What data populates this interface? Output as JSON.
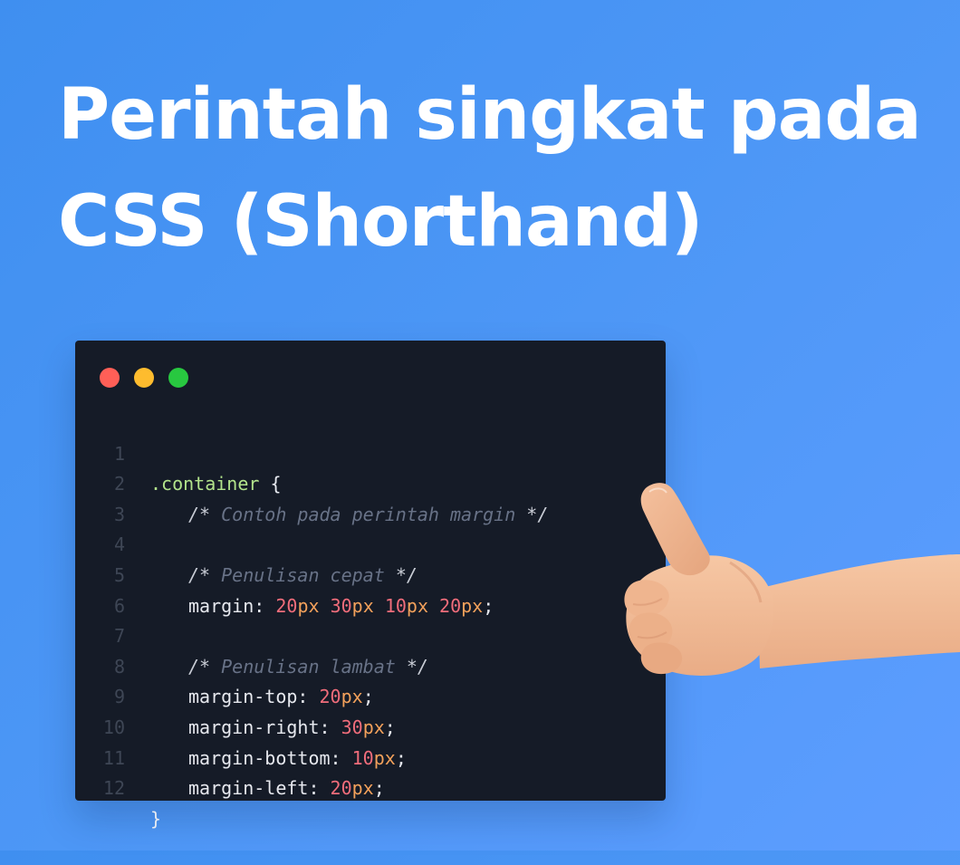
{
  "headline": {
    "line1": "Perintah singkat pada",
    "line2": "CSS (Shorthand)"
  },
  "editor": {
    "window_controls": [
      "red",
      "yellow",
      "green"
    ],
    "lines": [
      {
        "num": "1",
        "selector": ".container",
        "brace": "{"
      },
      {
        "num": "2",
        "comment_open": "/*",
        "comment_text": "Contoh pada perintah margin",
        "comment_close": "*/"
      },
      {
        "num": "3"
      },
      {
        "num": "4",
        "comment_open": "/*",
        "comment_text": "Penulisan cepat",
        "comment_close": "*/"
      },
      {
        "num": "5",
        "property": "margin",
        "colon": ":",
        "values": [
          {
            "num": "20",
            "unit": "px"
          },
          {
            "num": "30",
            "unit": "px"
          },
          {
            "num": "10",
            "unit": "px"
          },
          {
            "num": "20",
            "unit": "px"
          }
        ],
        "semicolon": ";"
      },
      {
        "num": "6"
      },
      {
        "num": "7",
        "comment_open": "/*",
        "comment_text": "Penulisan lambat",
        "comment_close": "*/"
      },
      {
        "num": "8",
        "property": "margin-top",
        "colon": ":",
        "values": [
          {
            "num": "20",
            "unit": "px"
          }
        ],
        "semicolon": ";"
      },
      {
        "num": "9",
        "property": "margin-right",
        "colon": ":",
        "values": [
          {
            "num": "30",
            "unit": "px"
          }
        ],
        "semicolon": ";"
      },
      {
        "num": "10",
        "property": "margin-bottom",
        "colon": ":",
        "values": [
          {
            "num": "10",
            "unit": "px"
          }
        ],
        "semicolon": ";"
      },
      {
        "num": "11",
        "property": "margin-left",
        "colon": ":",
        "values": [
          {
            "num": "20",
            "unit": "px"
          }
        ],
        "semicolon": ";"
      },
      {
        "num": "12",
        "brace": "}"
      }
    ]
  },
  "colors": {
    "background_start": "#3f8ff0",
    "background_end": "#5d9dff",
    "editor_background": "#151b27",
    "selector": "#b2e38b",
    "comment": "#687287",
    "number": "#f16d7b",
    "unit": "#f3a15b"
  },
  "illustration": {
    "icon": "thumbs-up-hand"
  }
}
